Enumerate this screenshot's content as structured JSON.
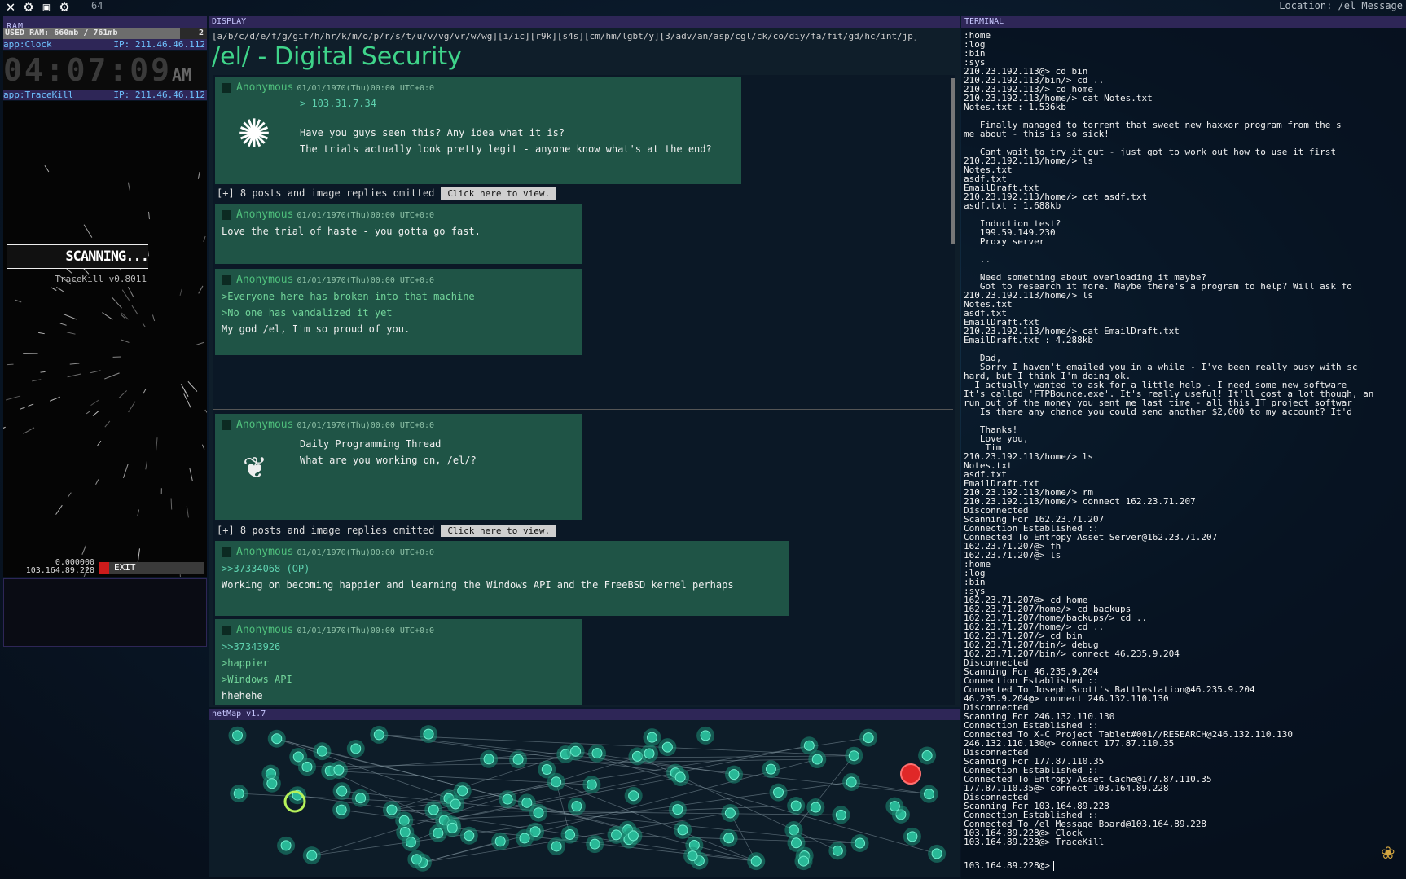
{
  "topbar": {
    "counter": "64",
    "location": "Location: /el Message"
  },
  "ram": {
    "title": "RAM",
    "used_label": "USED RAM: 660mb / 761mb",
    "fill_fraction": 0.867,
    "count": "2"
  },
  "clock": {
    "app": "app:Clock",
    "ip": "IP: 211.46.46.112",
    "time": "04:07:09",
    "ampm": "AM"
  },
  "tracekill": {
    "app": "app:TraceKill",
    "ip": "IP: 211.46.46.112",
    "status": "SCANNING...",
    "version": "TraceKill v0.8011",
    "value": "0.000000",
    "target_ip": "103.164.89.228",
    "exit_label": "EXIT"
  },
  "display": {
    "title": "DISPLAY",
    "boards": "[a/b/c/d/e/f/g/gif/h/hr/k/m/o/p/r/s/t/u/v/vg/vr/w/wg][i/ic][r9k][s4s][cm/hm/lgbt/y][3/adv/an/asp/cgl/ck/co/diy/fa/fit/gd/hc/int/jp]",
    "board_title": "/el/ - Digital Security",
    "author": "Anonymous",
    "date": "01/01/1970(Thu)00:00 UTC+0:0",
    "omitted": "[+] 8 posts and image replies omitted",
    "view_btn": "Click here to view.",
    "posts": [
      {
        "lines": [
          "> 103.31.7.34",
          "Have you guys seen this? Any idea what it is?",
          "The trials actually look pretty legit - anyone know what's at the end?"
        ]
      },
      {
        "lines": [
          "Love the trial of haste - you gotta go fast."
        ]
      },
      {
        "lines": [
          ">Everyone here has broken into that machine",
          ">No one has vandalized it yet",
          "My god /el, I'm so proud of you."
        ]
      },
      {
        "lines": [
          "Daily Programming Thread",
          "What are you working on, /el/?"
        ]
      },
      {
        "lines": [
          ">>37334068 (OP)",
          "Working on becoming happier and learning the Windows API and the FreeBSD kernel perhaps"
        ]
      },
      {
        "lines": [
          ">>37343926",
          ">happier",
          ">Windows API",
          "hhehehe"
        ]
      }
    ]
  },
  "netmap": {
    "title": "netMap v1.7"
  },
  "terminal": {
    "title": "TERMINAL",
    "lines": [
      ":home",
      ":log",
      ":bin",
      ":sys",
      "210.23.192.113@> cd bin",
      "210.23.192.113/bin/> cd ..",
      "210.23.192.113/> cd home",
      "210.23.192.113/home/> cat Notes.txt",
      "Notes.txt : 1.536kb",
      "",
      "   Finally managed to torrent that sweet new haxxor program from the s",
      "me about - this is so sick!",
      "",
      "   Cant wait to try it out - just got to work out how to use it first",
      "210.23.192.113/home/> ls",
      "Notes.txt",
      "asdf.txt",
      "EmailDraft.txt",
      "210.23.192.113/home/> cat asdf.txt",
      "asdf.txt : 1.688kb",
      "",
      "   Induction test?",
      "   199.59.149.230",
      "   Proxy server",
      "",
      "   ..",
      "",
      "   Need something about overloading it maybe?",
      "   Got to research it more. Maybe there's a program to help? Will ask fo",
      "210.23.192.113/home/> ls",
      "Notes.txt",
      "asdf.txt",
      "EmailDraft.txt",
      "210.23.192.113/home/> cat EmailDraft.txt",
      "EmailDraft.txt : 4.288kb",
      "",
      "   Dad,",
      "   Sorry I haven't emailed you in a while - I've been really busy with sc",
      "hard, but I think I'm doing ok.",
      "  I actually wanted to ask for a little help - I need some new software",
      "It's called 'FTPBounce.exe'. It's really useful! It'll cost a lot though, an",
      "run out of the money you sent me last time - all this IT project softwar",
      "   Is there any chance you could send another $2,000 to my account? It'd",
      "",
      "   Thanks!",
      "   Love you,",
      "    Tim",
      "210.23.192.113/home/> ls",
      "Notes.txt",
      "asdf.txt",
      "EmailDraft.txt",
      "210.23.192.113/home/> rm",
      "210.23.192.113/home/> connect 162.23.71.207",
      "Disconnected",
      "Scanning For 162.23.71.207",
      "Connection Established ::",
      "Connected To Entropy Asset Server@162.23.71.207",
      "162.23.71.207@> fh",
      "162.23.71.207@> ls",
      ":home",
      ":log",
      ":bin",
      ":sys",
      "162.23.71.207@> cd home",
      "162.23.71.207/home/> cd backups",
      "162.23.71.207/home/backups/> cd ..",
      "162.23.71.207/home/> cd ..",
      "162.23.71.207/> cd bin",
      "162.23.71.207/bin/> debug",
      "162.23.71.207/bin/> connect 46.235.9.204",
      "Disconnected",
      "Scanning For 46.235.9.204",
      "Connection Established ::",
      "Connected To Joseph Scott's Battlestation@46.235.9.204",
      "46.235.9.204@> connect 246.132.110.130",
      "Disconnected",
      "Scanning For 246.132.110.130",
      "Connection Established ::",
      "Connected To X-C Project Tablet#001//RESEARCH@246.132.110.130",
      "246.132.110.130@> connect 177.87.110.35",
      "Disconnected",
      "Scanning For 177.87.110.35",
      "Connection Established ::",
      "Connected To Entropy Asset Cache@177.87.110.35",
      "177.87.110.35@> connect 103.164.89.228",
      "Disconnected",
      "Scanning For 103.164.89.228",
      "Connection Established ::",
      "Connected To /el Message Board@103.164.89.228",
      "103.164.89.228@> Clock",
      "103.164.89.228@> TraceKill"
    ],
    "prompt": "103.164.89.228@>"
  }
}
